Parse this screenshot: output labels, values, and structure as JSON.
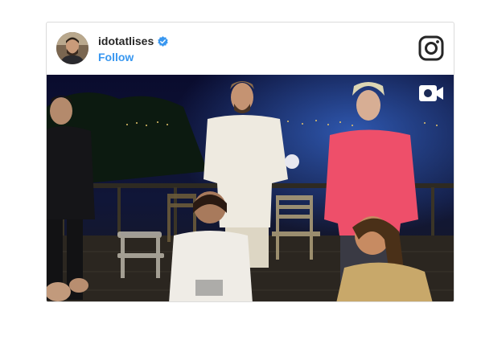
{
  "post": {
    "username": "idotatlises",
    "verified": true,
    "follow_label": "Follow",
    "media_type": "video"
  },
  "icons": {
    "logo": "instagram-logo-icon",
    "verified": "verified-badge-icon",
    "video": "video-camera-icon"
  },
  "colors": {
    "follow": "#3897f0",
    "verified_badge": "#3897f0",
    "username": "#262626",
    "border": "#dbdbdb"
  }
}
